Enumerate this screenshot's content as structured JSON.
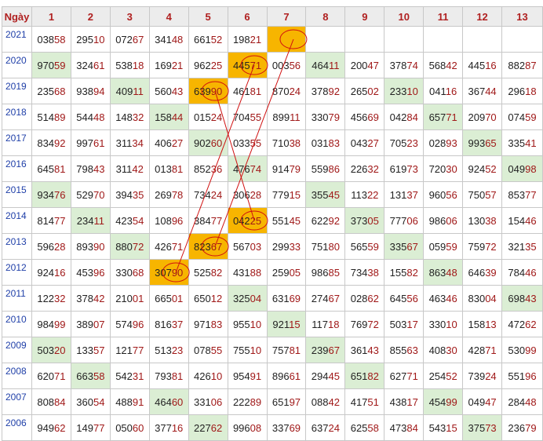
{
  "header": [
    "Ngày",
    "1",
    "2",
    "3",
    "4",
    "5",
    "6",
    "7",
    "8",
    "9",
    "10",
    "11",
    "12",
    "13"
  ],
  "rows": [
    {
      "year": "2021",
      "cells": [
        "03858",
        "29510",
        "07267",
        "34148",
        "66152",
        "19821",
        "",
        "",
        "",
        "",
        "",
        "",
        ""
      ]
    },
    {
      "year": "2020",
      "cells": [
        "97059",
        "32461",
        "53818",
        "16921",
        "96225",
        "44571",
        "00356",
        "46411",
        "20047",
        "37874",
        "56842",
        "44516",
        "88287"
      ]
    },
    {
      "year": "2019",
      "cells": [
        "23568",
        "93894",
        "40911",
        "56043",
        "63990",
        "46181",
        "87024",
        "37892",
        "26502",
        "23310",
        "04116",
        "36744",
        "29618"
      ]
    },
    {
      "year": "2018",
      "cells": [
        "51489",
        "54448",
        "14832",
        "15844",
        "01524",
        "70455",
        "89911",
        "33079",
        "45669",
        "04284",
        "65771",
        "20970",
        "07459"
      ]
    },
    {
      "year": "2017",
      "cells": [
        "83492",
        "99761",
        "31134",
        "40627",
        "90260",
        "03355",
        "71038",
        "03183",
        "04327",
        "70523",
        "02893",
        "99365",
        "33541"
      ]
    },
    {
      "year": "2016",
      "cells": [
        "64581",
        "79843",
        "31142",
        "01381",
        "85236",
        "47674",
        "91479",
        "55986",
        "22632",
        "61973",
        "72030",
        "92452",
        "04998"
      ]
    },
    {
      "year": "2015",
      "cells": [
        "93476",
        "52970",
        "39435",
        "26978",
        "73424",
        "30628",
        "77915",
        "35545",
        "11322",
        "13137",
        "96056",
        "75057",
        "85377"
      ]
    },
    {
      "year": "2014",
      "cells": [
        "81477",
        "23411",
        "42354",
        "10896",
        "38477",
        "04225",
        "55145",
        "62292",
        "37305",
        "77706",
        "98606",
        "13038",
        "15446"
      ]
    },
    {
      "year": "2013",
      "cells": [
        "59628",
        "89390",
        "88072",
        "42671",
        "82367",
        "56703",
        "29933",
        "75180",
        "56559",
        "33567",
        "05959",
        "75972",
        "32135"
      ]
    },
    {
      "year": "2012",
      "cells": [
        "92416",
        "45396",
        "33068",
        "30790",
        "52582",
        "43188",
        "25905",
        "98685",
        "73438",
        "15582",
        "86348",
        "64639",
        "78446"
      ]
    },
    {
      "year": "2011",
      "cells": [
        "12232",
        "37842",
        "21001",
        "66501",
        "65012",
        "32504",
        "63169",
        "27467",
        "02862",
        "64556",
        "46346",
        "83004",
        "69843"
      ]
    },
    {
      "year": "2010",
      "cells": [
        "98499",
        "38907",
        "57496",
        "81637",
        "97183",
        "95510",
        "92115",
        "11718",
        "76972",
        "50317",
        "33010",
        "15813",
        "47262"
      ]
    },
    {
      "year": "2009",
      "cells": [
        "50320",
        "13357",
        "12177",
        "51323",
        "07855",
        "75510",
        "75781",
        "23967",
        "36143",
        "85563",
        "40830",
        "42871",
        "53099"
      ]
    },
    {
      "year": "2008",
      "cells": [
        "62071",
        "66358",
        "54231",
        "79381",
        "42610",
        "95491",
        "89661",
        "29445",
        "65182",
        "62771",
        "25452",
        "73924",
        "55196"
      ]
    },
    {
      "year": "2007",
      "cells": [
        "80884",
        "36054",
        "48891",
        "46460",
        "33106",
        "22289",
        "65197",
        "08842",
        "41751",
        "43817",
        "45499",
        "04947",
        "28448"
      ]
    },
    {
      "year": "2006",
      "cells": [
        "94962",
        "14977",
        "05060",
        "37716",
        "22762",
        "99608",
        "33769",
        "63724",
        "62558",
        "47384",
        "54315",
        "37573",
        "23679"
      ]
    }
  ],
  "highlights": {
    "green": [
      [
        1,
        0
      ],
      [
        1,
        7
      ],
      [
        2,
        2
      ],
      [
        2,
        9
      ],
      [
        3,
        3
      ],
      [
        3,
        10
      ],
      [
        4,
        4
      ],
      [
        4,
        11
      ],
      [
        5,
        5
      ],
      [
        5,
        12
      ],
      [
        6,
        0
      ],
      [
        6,
        7
      ],
      [
        7,
        1
      ],
      [
        7,
        8
      ],
      [
        8,
        2
      ],
      [
        8,
        9
      ],
      [
        9,
        10
      ],
      [
        10,
        5
      ],
      [
        10,
        12
      ],
      [
        11,
        6
      ],
      [
        12,
        0
      ],
      [
        12,
        7
      ],
      [
        13,
        1
      ],
      [
        13,
        8
      ],
      [
        14,
        3
      ],
      [
        14,
        10
      ],
      [
        15,
        4
      ],
      [
        15,
        11
      ]
    ],
    "orange": [
      [
        0,
        6
      ],
      [
        1,
        5
      ],
      [
        2,
        4
      ],
      [
        7,
        5
      ],
      [
        8,
        4
      ],
      [
        9,
        3
      ]
    ]
  },
  "colors": {
    "header_text": "#b02020",
    "year_text": "#1f3fa8",
    "tail_text": "#a01818",
    "green": "#dbeed4",
    "orange": "#f7b500",
    "annotation": "#d01010"
  }
}
